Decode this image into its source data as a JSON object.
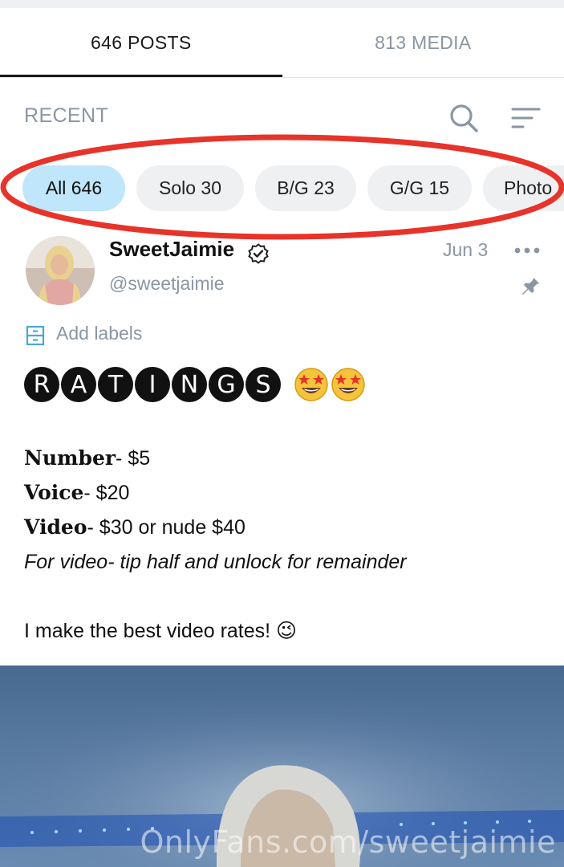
{
  "tabs": [
    {
      "label": "646 POSTS",
      "active": true
    },
    {
      "label": "813 MEDIA",
      "active": false
    }
  ],
  "section": {
    "title": "RECENT",
    "icons": [
      "search-icon",
      "sort-icon"
    ]
  },
  "chips": [
    {
      "label": "All 646",
      "active": true
    },
    {
      "label": "Solo 30",
      "active": false
    },
    {
      "label": "B/G 23",
      "active": false
    },
    {
      "label": "G/G 15",
      "active": false
    },
    {
      "label": "Photo",
      "active": false
    }
  ],
  "post": {
    "author": "SweetJaimie",
    "handle": "@sweetjaimie",
    "date": "Jun 3",
    "add_labels": "Add labels",
    "heading_letters": [
      "R",
      "A",
      "T",
      "I",
      "N",
      "G",
      "S"
    ],
    "lines": [
      {
        "label": "Number",
        "value": "- $5"
      },
      {
        "label": "Voice",
        "value": "- $20"
      },
      {
        "label": "Video",
        "value": "- $30 or nude $40"
      }
    ],
    "note": "For video- tip half and unlock for remainder",
    "closing": "I make the best video rates! 😉",
    "emoji": "🤩🤩"
  },
  "media": {
    "watermark": "OnlyFans.com/sweetjaimie"
  },
  "colors": {
    "accent_chip": "#bfe6fa",
    "highlight_ellipse": "#e8332a",
    "muted_text": "#8a96a3"
  }
}
